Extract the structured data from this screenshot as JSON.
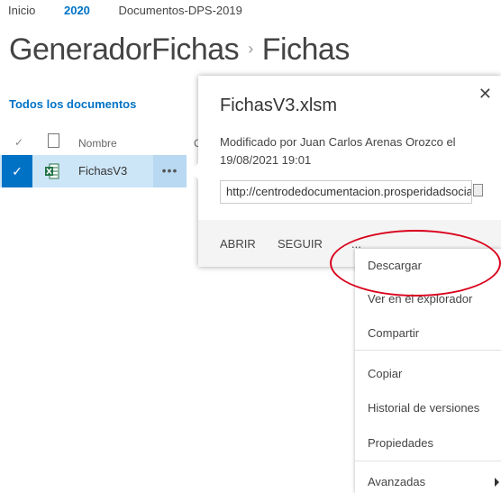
{
  "breadcrumb": {
    "home": "Inicio",
    "year": "2020",
    "library": "Documentos-DPS-2019"
  },
  "page": {
    "site": "GeneradorFichas",
    "separator": "›",
    "section": "Fichas"
  },
  "view": {
    "label": "Todos los documentos"
  },
  "list": {
    "header_check": "✓",
    "header_name": "Nombre",
    "header_col2": "C",
    "row_check": "✓",
    "row_name": "FichasV3",
    "row_more": "•••"
  },
  "callout": {
    "title": "FichasV3.xlsm",
    "close": "✕",
    "modified": "Modificado por Juan Carlos Arenas Orozco el 19/08/2021 19:01",
    "url": "http://centrodedocumentacion.prosperidadsocial.gov.co",
    "actions": {
      "open": "ABRIR",
      "follow": "SEGUIR",
      "more": "..."
    }
  },
  "menu": {
    "download": "Descargar",
    "view_browser": "Ver en el explorador",
    "share": "Compartir",
    "copy": "Copiar",
    "version_history": "Historial de versiones",
    "properties": "Propiedades",
    "advanced": "Avanzadas"
  },
  "colors": {
    "accent": "#0072c6",
    "highlight": "#d9001b",
    "excel": "#217346"
  }
}
